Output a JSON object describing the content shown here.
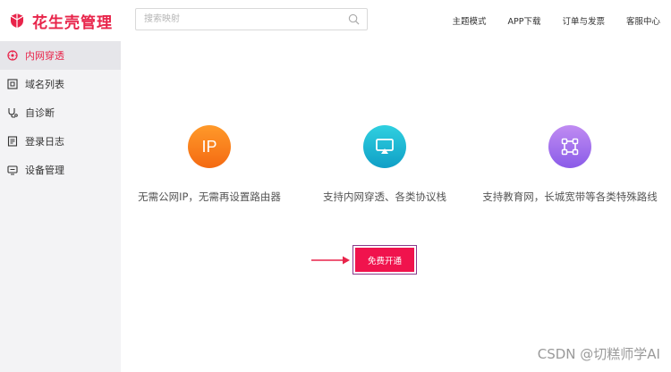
{
  "app": {
    "title": "花生壳管理"
  },
  "sidebar": {
    "items": [
      {
        "label": "内网穿透",
        "icon": "tunnel-icon",
        "active": true
      },
      {
        "label": "域名列表",
        "icon": "domain-list-icon",
        "active": false
      },
      {
        "label": "自诊断",
        "icon": "diagnose-icon",
        "active": false
      },
      {
        "label": "登录日志",
        "icon": "log-icon",
        "active": false
      },
      {
        "label": "设备管理",
        "icon": "device-icon",
        "active": false
      }
    ]
  },
  "header": {
    "search": {
      "placeholder": "搜索映射",
      "value": ""
    },
    "nav": [
      "主题模式",
      "APP下载",
      "订单与发票",
      "客服中心"
    ]
  },
  "features": [
    {
      "text": "无需公网IP，无需再设置路由器",
      "icon": "ip-icon",
      "badge": "IP"
    },
    {
      "text": "支持内网穿透、各类协议栈",
      "icon": "screen-cast-icon"
    },
    {
      "text": "支持教育网，长城宽带等各类特殊路线",
      "icon": "network-nodes-icon"
    }
  ],
  "cta": {
    "label": "免费开通"
  },
  "watermark": "CSDN @切糕师学AI",
  "colors": {
    "brand": "#e8244a",
    "cta": "#f0134d",
    "sidebar_bg": "#f3f3f5",
    "arrow": "#e8244a"
  }
}
